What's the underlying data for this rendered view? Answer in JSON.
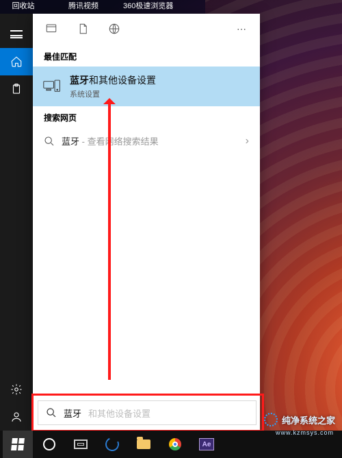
{
  "desktop": {
    "icons": [
      "回收站",
      "腾讯视频",
      "360极速浏览器"
    ]
  },
  "leftrail": {
    "items": [
      "menu",
      "home",
      "clipboard"
    ],
    "bottom": [
      "settings",
      "profile"
    ]
  },
  "filters": {
    "icons": [
      "apps",
      "documents",
      "web"
    ],
    "more": "⋯"
  },
  "sections": {
    "best_match_label": "最佳匹配",
    "web_label": "搜索网页"
  },
  "best_match": {
    "title_bold": "蓝牙",
    "title_rest": "和其他设备设置",
    "subtitle": "系统设置"
  },
  "web_result": {
    "term": "蓝牙",
    "hint": " - 查看网络搜索结果",
    "chevron": "›"
  },
  "search": {
    "typed": "蓝牙",
    "ghost": "和其他设备设置"
  },
  "taskbar": {
    "buttons": [
      "start",
      "cortana",
      "taskview",
      "edge",
      "explorer",
      "chrome",
      "aftereffects"
    ]
  },
  "watermark": {
    "text": "纯净系统之家",
    "sub": "www.kzmsys.com"
  }
}
